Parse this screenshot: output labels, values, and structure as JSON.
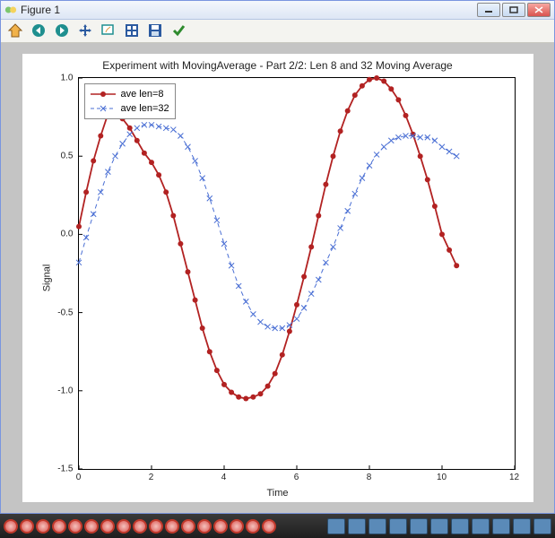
{
  "window": {
    "title": "Figure 1"
  },
  "toolbar": {
    "home": "Home",
    "back": "Back",
    "forward": "Forward",
    "pan": "Pan",
    "zoom": "Zoom",
    "subplots": "Configure subplots",
    "save": "Save",
    "edit": "Edit"
  },
  "chart_data": {
    "type": "line",
    "title": "Experiment with MovingAverage - Part 2/2: Len 8 and 32 Moving Average",
    "xlabel": "Time",
    "ylabel": "Signal",
    "xlim": [
      0,
      12
    ],
    "ylim": [
      -1.5,
      1.0
    ],
    "xticks": [
      0,
      2,
      4,
      6,
      8,
      10,
      12
    ],
    "yticks": [
      -1.5,
      -1.0,
      -0.5,
      0.0,
      0.5,
      1.0
    ],
    "legend_position": "upper-left",
    "series": [
      {
        "name": "ave len=8",
        "color": "#b22222",
        "marker": "dot",
        "x": [
          0.0,
          0.2,
          0.4,
          0.6,
          0.8,
          1.0,
          1.2,
          1.4,
          1.6,
          1.8,
          2.0,
          2.2,
          2.4,
          2.6,
          2.8,
          3.0,
          3.2,
          3.4,
          3.6,
          3.8,
          4.0,
          4.2,
          4.4,
          4.6,
          4.8,
          5.0,
          5.2,
          5.4,
          5.6,
          5.8,
          6.0,
          6.2,
          6.4,
          6.6,
          6.8,
          7.0,
          7.2,
          7.4,
          7.6,
          7.8,
          8.0,
          8.2,
          8.4,
          8.6,
          8.8,
          9.0,
          9.2,
          9.4,
          9.6,
          9.8,
          10.0,
          10.2,
          10.4
        ],
        "y": [
          0.05,
          0.27,
          0.47,
          0.63,
          0.77,
          0.78,
          0.74,
          0.68,
          0.6,
          0.52,
          0.46,
          0.38,
          0.27,
          0.12,
          -0.06,
          -0.24,
          -0.42,
          -0.6,
          -0.75,
          -0.87,
          -0.96,
          -1.01,
          -1.04,
          -1.05,
          -1.04,
          -1.02,
          -0.97,
          -0.89,
          -0.77,
          -0.62,
          -0.45,
          -0.27,
          -0.08,
          0.12,
          0.32,
          0.5,
          0.66,
          0.79,
          0.89,
          0.95,
          0.99,
          1.0,
          0.98,
          0.93,
          0.86,
          0.76,
          0.64,
          0.5,
          0.35,
          0.18,
          0.0,
          -0.1,
          -0.2
        ]
      },
      {
        "name": "ave len=32",
        "color": "#4a6fd4",
        "marker": "x",
        "dash": true,
        "x": [
          0.0,
          0.2,
          0.4,
          0.6,
          0.8,
          1.0,
          1.2,
          1.4,
          1.6,
          1.8,
          2.0,
          2.2,
          2.4,
          2.6,
          2.8,
          3.0,
          3.2,
          3.4,
          3.6,
          3.8,
          4.0,
          4.2,
          4.4,
          4.6,
          4.8,
          5.0,
          5.2,
          5.4,
          5.6,
          5.8,
          6.0,
          6.2,
          6.4,
          6.6,
          6.8,
          7.0,
          7.2,
          7.4,
          7.6,
          7.8,
          8.0,
          8.2,
          8.4,
          8.6,
          8.8,
          9.0,
          9.2,
          9.4,
          9.6,
          9.8,
          10.0,
          10.2,
          10.4
        ],
        "y": [
          -0.18,
          -0.02,
          0.13,
          0.27,
          0.4,
          0.5,
          0.58,
          0.64,
          0.68,
          0.7,
          0.7,
          0.69,
          0.68,
          0.67,
          0.63,
          0.56,
          0.47,
          0.36,
          0.23,
          0.09,
          -0.06,
          -0.2,
          -0.33,
          -0.43,
          -0.51,
          -0.56,
          -0.59,
          -0.6,
          -0.6,
          -0.58,
          -0.54,
          -0.47,
          -0.38,
          -0.29,
          -0.18,
          -0.08,
          0.04,
          0.15,
          0.26,
          0.36,
          0.44,
          0.51,
          0.56,
          0.6,
          0.62,
          0.63,
          0.63,
          0.62,
          0.62,
          0.6,
          0.56,
          0.53,
          0.5
        ]
      }
    ]
  }
}
